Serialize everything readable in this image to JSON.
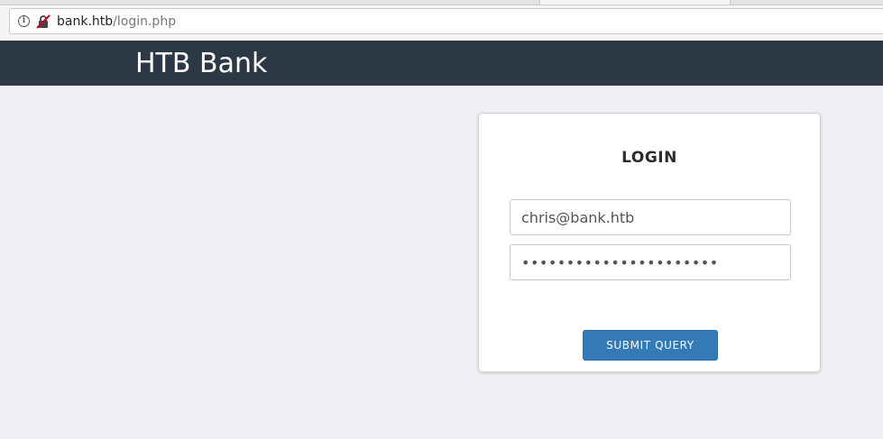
{
  "browser": {
    "url_host": "bank.htb",
    "url_path": "/login.php",
    "info_icon_glyph": "i"
  },
  "site": {
    "title": "HTB Bank"
  },
  "login": {
    "heading": "LOGIN",
    "email_value": "chris@bank.htb",
    "password_value": "1234567890123456789012",
    "submit_label": "SUBMIT QUERY"
  },
  "colors": {
    "header_bg": "#2c3845",
    "page_bg": "#eef0f3",
    "button_bg": "#337ab7"
  },
  "icons": [
    "info-icon",
    "insecure-lock-icon"
  ]
}
